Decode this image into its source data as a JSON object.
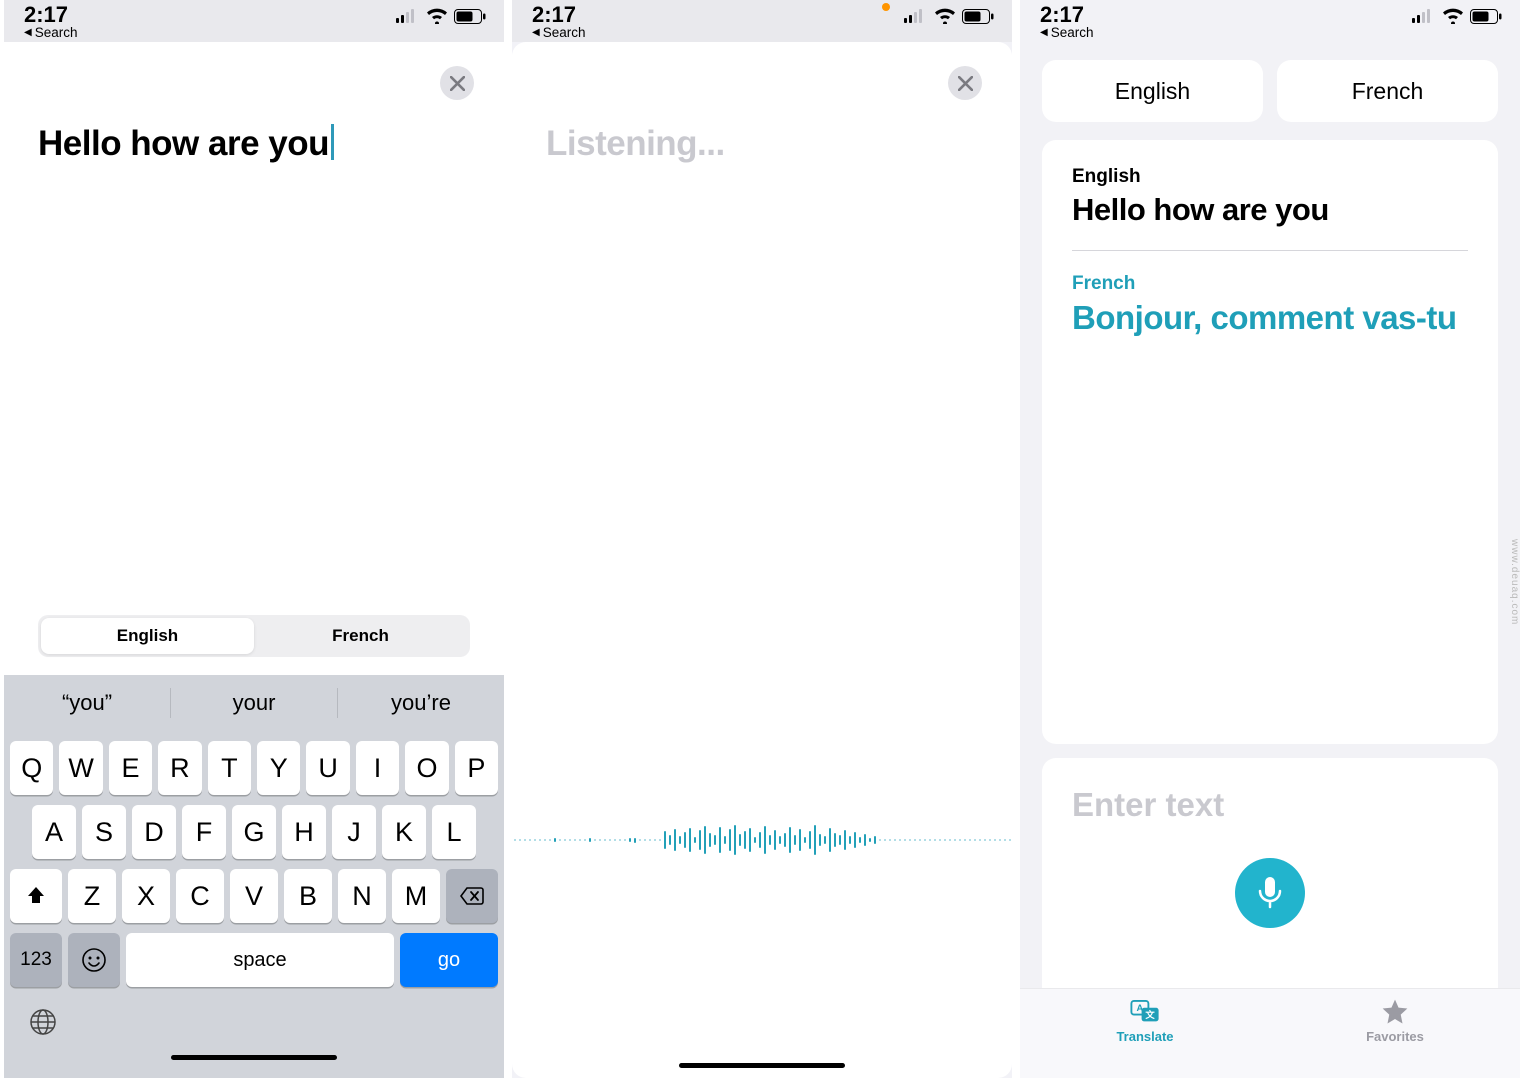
{
  "status": {
    "time": "2:17",
    "back_label": "Search"
  },
  "screen1": {
    "input_text": "Hello how are you",
    "segmented": {
      "a": "English",
      "b": "French"
    },
    "suggestions": [
      "“you”",
      "your",
      "you’re"
    ],
    "keys_r1": [
      "Q",
      "W",
      "E",
      "R",
      "T",
      "Y",
      "U",
      "I",
      "O",
      "P"
    ],
    "keys_r2": [
      "A",
      "S",
      "D",
      "F",
      "G",
      "H",
      "J",
      "K",
      "L"
    ],
    "keys_r3": [
      "Z",
      "X",
      "C",
      "V",
      "B",
      "N",
      "M"
    ],
    "key_123": "123",
    "key_space": "space",
    "key_go": "go"
  },
  "screen2": {
    "listening": "Listening..."
  },
  "screen3": {
    "lang_a": "English",
    "lang_b": "French",
    "src_label": "English",
    "src_text": "Hello how are you",
    "dst_label": "French",
    "dst_text": "Bonjour, comment vas-tu",
    "placeholder": "Enter text",
    "tab_translate": "Translate",
    "tab_favorites": "Favorites"
  },
  "watermark": "www.deuaq.com"
}
